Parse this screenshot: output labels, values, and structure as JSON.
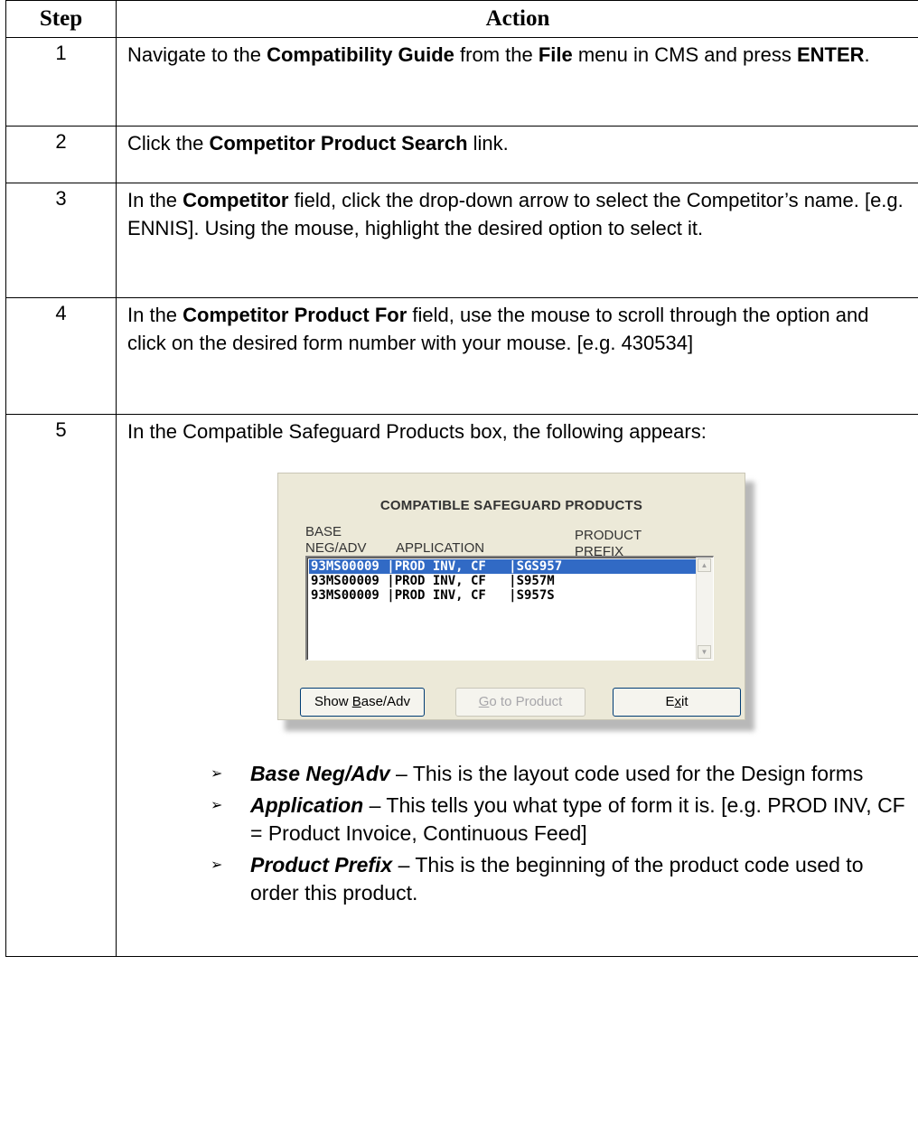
{
  "table": {
    "header": {
      "step": "Step",
      "action": "Action"
    },
    "steps": [
      {
        "num": "1",
        "parts": [
          "Navigate to the ",
          "Compatibility Guide",
          " from the ",
          "File",
          " menu in CMS and press ",
          "ENTER",
          "."
        ]
      },
      {
        "num": "2",
        "parts": [
          "Click the ",
          "Competitor Product Search",
          " link."
        ]
      },
      {
        "num": "3",
        "parts": [
          "In the ",
          "Competitor",
          " field, click the drop-down arrow to select the Competitor’s name. [e.g. ENNIS]. Using the mouse, highlight the desired option to select it."
        ]
      },
      {
        "num": "4",
        "parts": [
          "In the ",
          "Competitor Product For",
          " field, use the mouse to scroll through the option and click on the desired form number with your mouse. [e.g. 430534]"
        ]
      },
      {
        "num": "5",
        "intro": "In the Compatible Safeguard Products box, the following appears:"
      }
    ]
  },
  "dialog": {
    "title": "COMPATIBLE SAFEGUARD PRODUCTS",
    "col_base_line1": "BASE",
    "col_base_line2": "NEG/ADV",
    "col_application": "APPLICATION",
    "col_prefix_line1": "PRODUCT",
    "col_prefix_line2": "PREFIX",
    "rows": [
      {
        "text": "93MS00009 |PROD INV, CF   |SGS957",
        "selected": true
      },
      {
        "text": "93MS00009 |PROD INV, CF   |S957M",
        "selected": false
      },
      {
        "text": "93MS00009 |PROD INV, CF   |S957S",
        "selected": false
      }
    ],
    "buttons": {
      "show_pre": "Show ",
      "show_key": "B",
      "show_post": "ase/Adv",
      "goto_key": "G",
      "goto_post": "o to Product",
      "exit_pre": "E",
      "exit_key": "x",
      "exit_post": "it"
    },
    "scroll_up_icon": "arrow-up-icon",
    "scroll_down_icon": "arrow-down-icon",
    "selection_color": "#316ac5"
  },
  "definitions": [
    {
      "term": "Base Neg/Adv",
      "text": " – This is the layout code used for the Design forms"
    },
    {
      "term": "Application",
      "text": " – This tells you what type of form it is. [e.g. PROD INV, CF = Product Invoice, Continuous Feed]"
    },
    {
      "term": "Product Prefix",
      "text": " – This is the beginning of the product code used to order this product."
    }
  ],
  "bullet_glyph": "➢"
}
